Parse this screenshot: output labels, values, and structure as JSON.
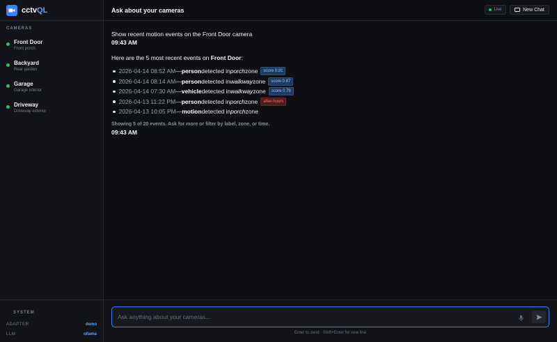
{
  "brand": {
    "prefix": "cctv",
    "suffix": "QL"
  },
  "sidebar": {
    "cameras_label": "CAMERAS",
    "cameras": [
      {
        "name": "Front Door",
        "desc": "Front porch",
        "status_color": "#22c55e"
      },
      {
        "name": "Backyard",
        "desc": "Rear garden",
        "status_color": "#22c55e"
      },
      {
        "name": "Garage",
        "desc": "Garage interior",
        "status_color": "#22c55e"
      },
      {
        "name": "Driveway",
        "desc": "Driveway exterior",
        "status_color": "#22c55e"
      }
    ],
    "system_label": "SYSTEM",
    "adapter_key": "ADAPTER",
    "adapter_value": "demo",
    "llm_key": "LLM",
    "llm_value": "ollama"
  },
  "header": {
    "title": "Ask about your cameras",
    "live_label": "Live",
    "new_chat_label": "New Chat"
  },
  "chat": {
    "user_message": "Show recent motion events on the Front Door camera",
    "user_time": "09:43 AM",
    "intro_prefix": "Here are the 5 most recent events on ",
    "intro_camera": "Front Door",
    "intro_suffix": ":",
    "events": [
      {
        "time": "2026-04-14 08:52 AM",
        "label": "person",
        "zone": "porch",
        "badge": "score 0.91",
        "badge_type": "score"
      },
      {
        "time": "2026-04-14 08:14 AM",
        "label": "person",
        "zone": "walkway",
        "badge": "score 0.87",
        "badge_type": "score"
      },
      {
        "time": "2026-04-14 07:30 AM",
        "label": "vehicle",
        "zone": "walkway",
        "badge": "score 0.79",
        "badge_type": "score"
      },
      {
        "time": "2026-04-13 11:22 PM",
        "label": "person",
        "zone": "porch",
        "badge": "after-hours",
        "badge_type": "after"
      },
      {
        "time": "2026-04-13 10:05 PM",
        "label": "motion",
        "zone": "porch",
        "badge": "",
        "badge_type": ""
      }
    ],
    "dash": " — ",
    "detected_in": " detected in ",
    "zone_word": " zone",
    "summary": "Showing 5 of 20 events. Ask for more or filter by label, zone, or time.",
    "reply_time": "09:43 AM"
  },
  "composer": {
    "placeholder": "Ask anything about your cameras...",
    "hint": "Enter to send  ·  Shift+Enter for new line"
  },
  "colors": {
    "accent": "#3b82f6",
    "live": "#22c55e",
    "after_hours": "#f87171"
  }
}
